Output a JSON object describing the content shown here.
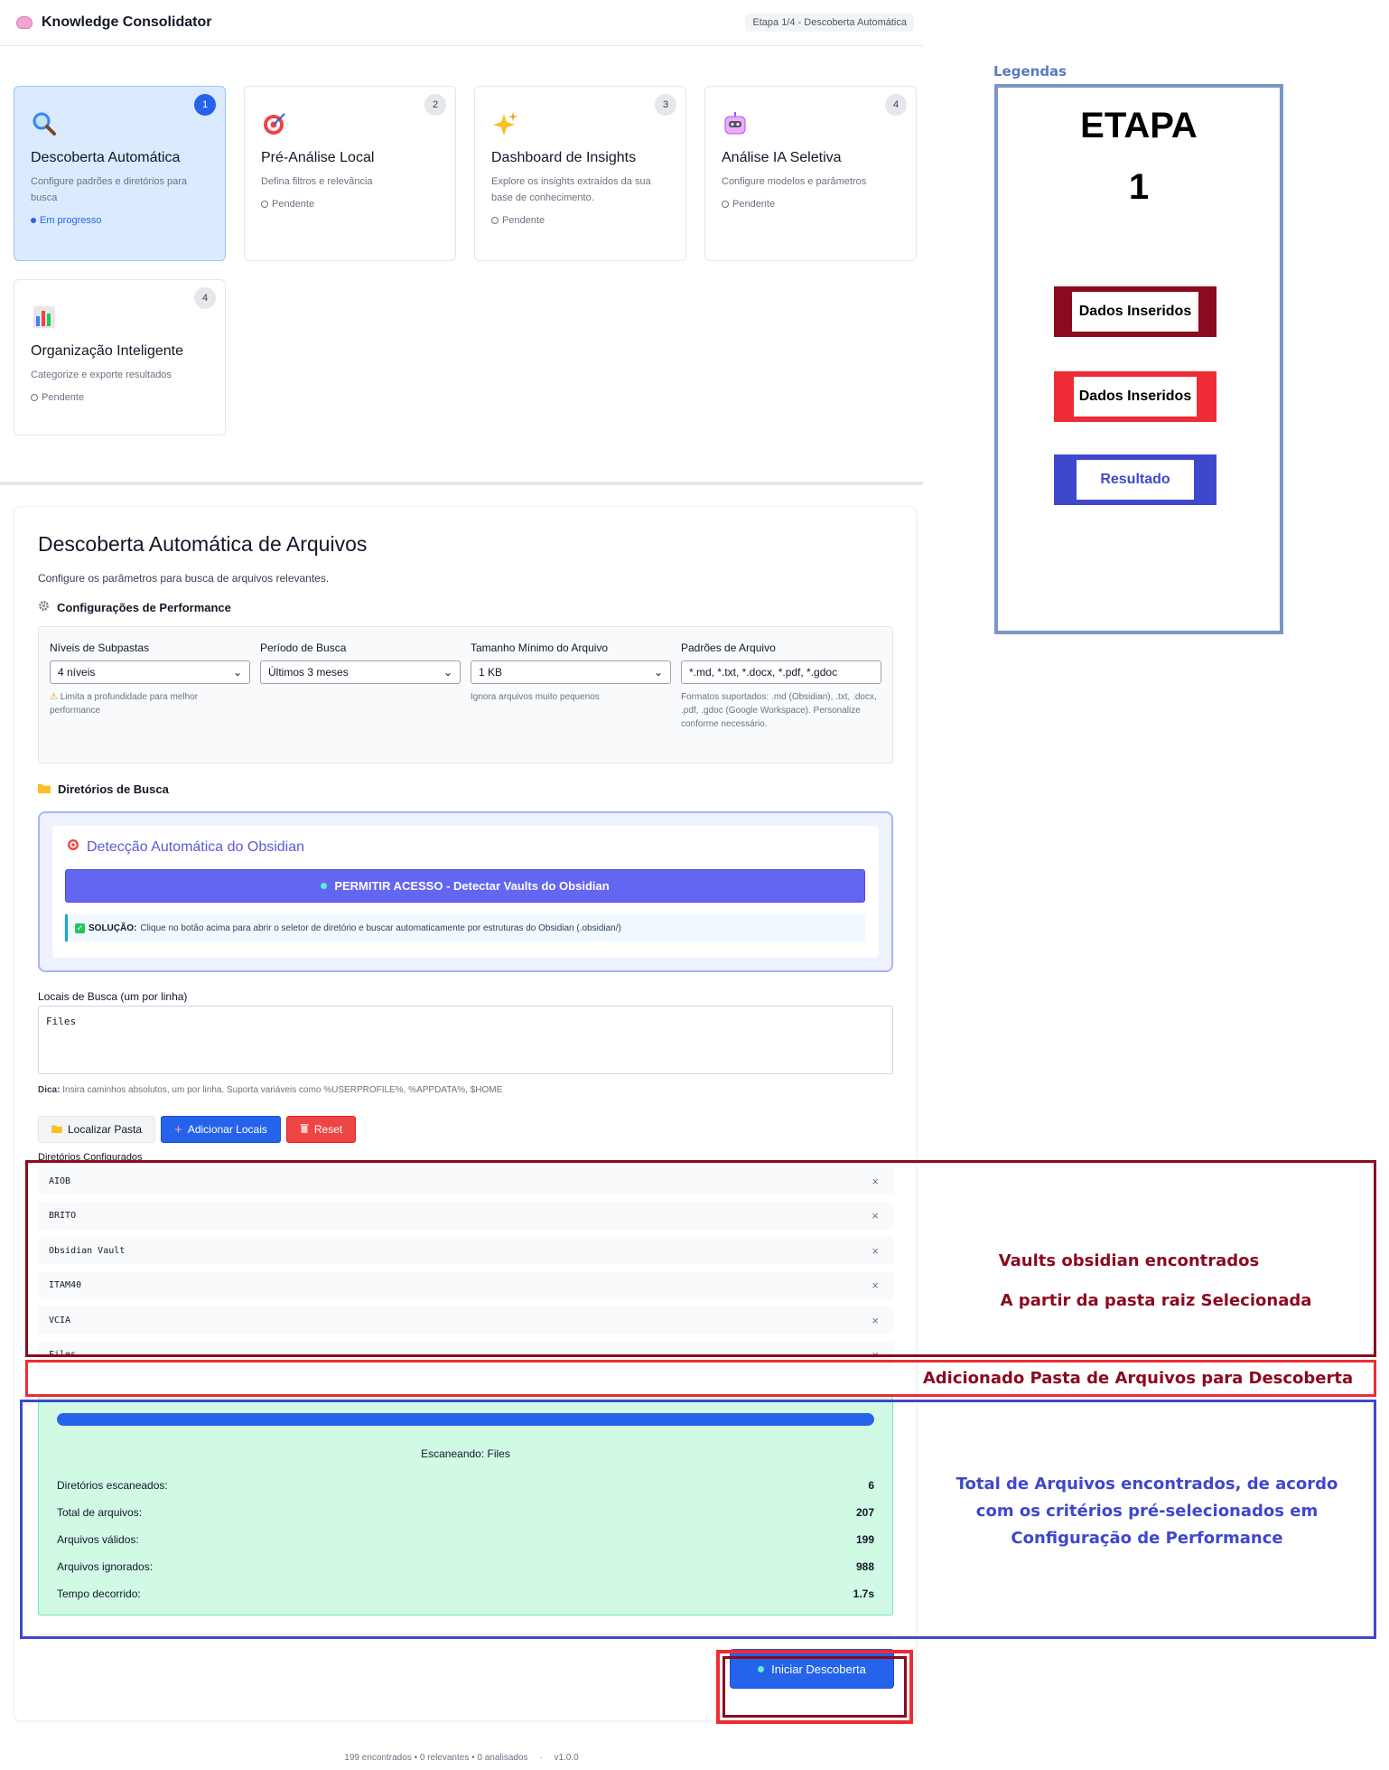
{
  "header": {
    "app_title": "Knowledge Consolidator",
    "stage_badge": "Etapa 1/4 - Descoberta Automática"
  },
  "steps": [
    {
      "number": "1",
      "title": "Descoberta Automática",
      "desc": "Configure padrões e diretórios para busca",
      "status": "Em progresso",
      "icon": "magnifier-icon"
    },
    {
      "number": "2",
      "title": "Pré-Análise Local",
      "desc": "Defina filtros e relevância",
      "status": "Pendente",
      "icon": "target-icon"
    },
    {
      "number": "3",
      "title": "Dashboard de Insights",
      "desc": "Explore os insights extraídos da sua base de conhecimento.",
      "status": "Pendente",
      "icon": "sparkles-icon"
    },
    {
      "number": "4",
      "title": "Análise IA Seletiva",
      "desc": "Configure modelos e parâmetros",
      "status": "Pendente",
      "icon": "robot-icon"
    },
    {
      "number": "4",
      "title": "Organização Inteligente",
      "desc": "Categorize e exporte resultados",
      "status": "Pendente",
      "icon": "bar-chart-icon"
    }
  ],
  "main": {
    "title": "Descoberta Automática de Arquivos",
    "subtitle": "Configure os parâmetros para busca de arquivos relevantes.",
    "perf_heading": "Configurações de Performance",
    "perf": {
      "levels_label": "Níveis de Subpastas",
      "levels_value": "4 níveis",
      "levels_help": "Limita a profundidade para melhor performance",
      "period_label": "Período de Busca",
      "period_value": "Últimos 3 meses",
      "size_label": "Tamanho Mínimo do Arquivo",
      "size_value": "1 KB",
      "size_help": "Ignora arquivos muito pequenos",
      "patterns_label": "Padrões de Arquivo",
      "patterns_value": "*.md, *.txt, *.docx, *.pdf, *.gdoc",
      "patterns_help": "Formatos suportados: .md (Obsidian), .txt, .docx, .pdf, .gdoc (Google Workspace). Personalize conforme necessário."
    },
    "dirs_heading": "Diretórios de Busca",
    "obsidian": {
      "title": "Detecção Automática do Obsidian",
      "button": "PERMITIR ACESSO - Detectar Vaults do Obsidian",
      "solution_label": "SOLUÇÃO:",
      "solution_text": "Clique no botão acima para abrir o seletor de diretório e buscar automaticamente por estruturas do Obsidian (.obsidian/)"
    },
    "locais_label": "Locais de Busca (um por linha)",
    "locais_value": "Files",
    "dica_label": "Dica:",
    "dica_text": "Insira caminhos absolutos, um por linha. Suporta variáveis como %USERPROFILE%, %APPDATA%, $HOME",
    "buttons": {
      "locate": "Localizar Pasta",
      "add": "Adicionar Locais",
      "reset": "Reset"
    },
    "configured_label": "Diretórios Configurados",
    "configured_dirs": [
      "AIOB",
      "BRITO",
      "Obsidian Vault",
      "ITAM40",
      "VCIA",
      "Files"
    ],
    "scan": {
      "progress": 1.0,
      "title": "Escaneando: Files",
      "stats": [
        {
          "label": "Diretórios escaneados:",
          "value": "6"
        },
        {
          "label": "Total de arquivos:",
          "value": "207"
        },
        {
          "label": "Arquivos válidos:",
          "value": "199"
        },
        {
          "label": "Arquivos ignorados:",
          "value": "988"
        },
        {
          "label": "Tempo decorrido:",
          "value": "1.7s"
        }
      ]
    },
    "start_button": "Iniciar Descoberta"
  },
  "footer": {
    "stats": "199 encontrados • 0 relevantes • 0 analisados",
    "version": "v1.0.0"
  },
  "annotations": {
    "vaults_line1": "Vaults obsidian encontrados",
    "vaults_line2": "A partir da pasta raiz Selecionada",
    "added_folder": "Adicionado Pasta de Arquivos para Descoberta",
    "total_line1": "Total de Arquivos encontrados, de acordo",
    "total_line2": "com os critérios  pré-selecionados em",
    "total_line3": "Configuração de Performance"
  },
  "legend": {
    "label": "Legendas",
    "etapa": "ETAPA",
    "number": "1",
    "chips": [
      "Dados Inseridos",
      "Dados Inseridos",
      "Resultado"
    ]
  },
  "colors": {
    "dark_red": "#8b0a1e",
    "red": "#ef2b35",
    "blue": "#3f48cc",
    "accent": "#2563eb"
  }
}
